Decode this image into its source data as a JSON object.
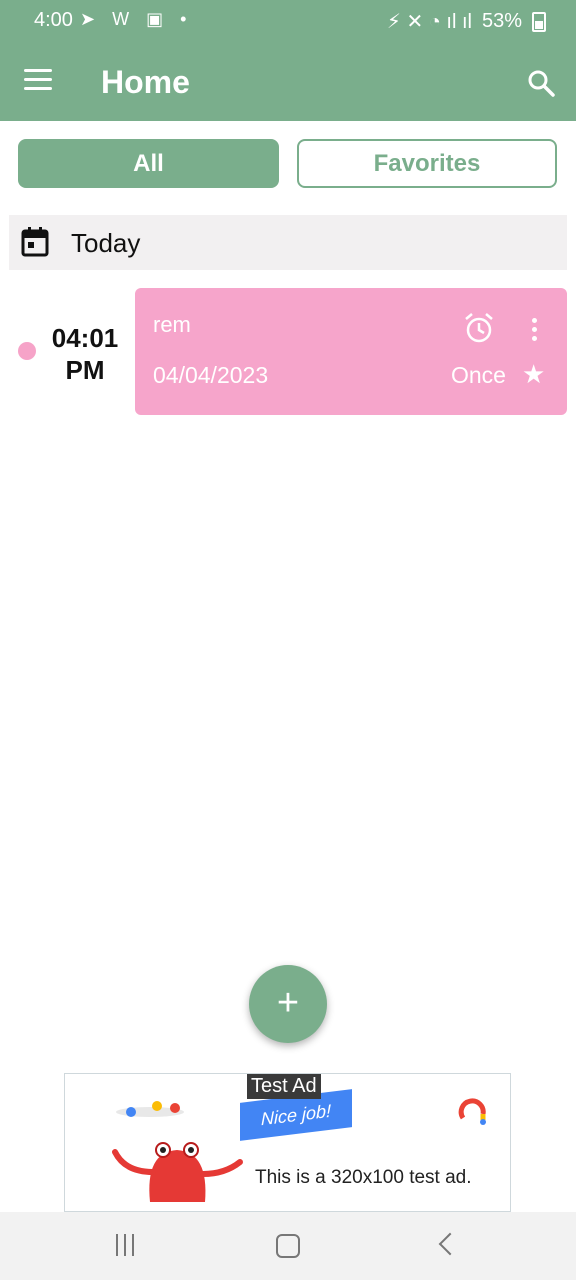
{
  "status_bar": {
    "time": "4:00",
    "battery": "53%"
  },
  "app_bar": {
    "title": "Home"
  },
  "filters": {
    "all_label": "All",
    "favorites_label": "Favorites"
  },
  "section": {
    "label": "Today"
  },
  "reminders": [
    {
      "time": "04:01",
      "ampm": "PM",
      "title": "rem",
      "date": "04/04/2023",
      "repeat": "Once",
      "color": "#f6a5cb"
    }
  ],
  "ad": {
    "badge": "Test Ad",
    "banner_text": "Nice job!",
    "body": "This is a 320x100 test ad."
  },
  "colors": {
    "primary": "#7aae8c",
    "card": "#f6a5cb",
    "section_bg": "#f2f0f1"
  },
  "icons": [
    "hamburger-icon",
    "search-icon",
    "calendar-icon",
    "alarm-icon",
    "more-vert-icon",
    "star-icon",
    "add-icon"
  ]
}
